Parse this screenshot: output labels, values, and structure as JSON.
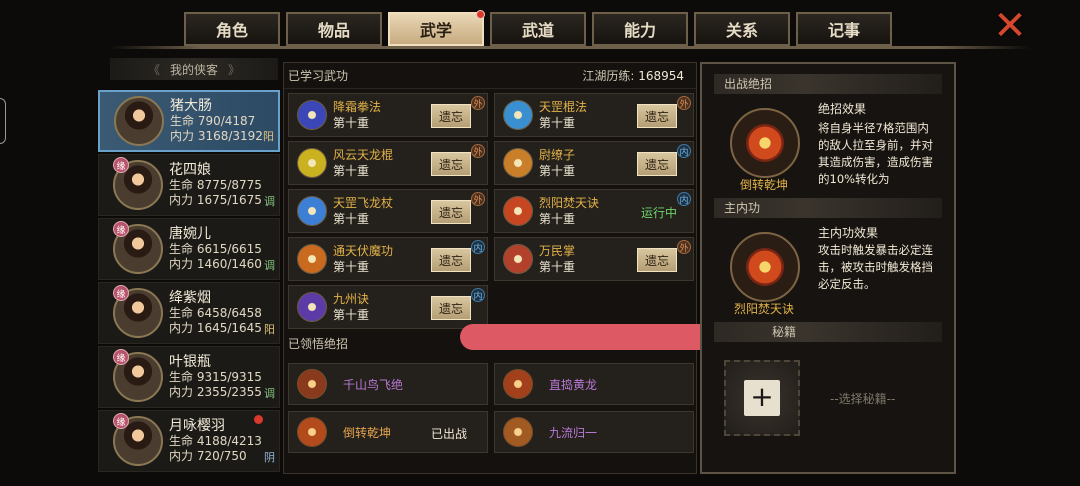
{
  "tabs": [
    {
      "label": "角色",
      "active": false
    },
    {
      "label": "物品",
      "active": false
    },
    {
      "label": "武学",
      "active": true,
      "notify": true
    },
    {
      "label": "武道",
      "active": false
    },
    {
      "label": "能力",
      "active": false
    },
    {
      "label": "关系",
      "active": false
    },
    {
      "label": "记事",
      "active": false
    }
  ],
  "left": {
    "title": "我的侠客",
    "characters": [
      {
        "name": "猪大肠",
        "hp": "生命 790/4187",
        "mp": "内力 3168/3192",
        "tag": "阳",
        "selected": true
      },
      {
        "name": "花四娘",
        "hp": "生命 8775/8775",
        "mp": "内力 1675/1675",
        "tag": "调",
        "badge": "缘"
      },
      {
        "name": "唐婉儿",
        "hp": "生命 6615/6615",
        "mp": "内力 1460/1460",
        "tag": "调",
        "badge": "缘"
      },
      {
        "name": "绛紫烟",
        "hp": "生命 6458/6458",
        "mp": "内力 1645/1645",
        "tag": "阳",
        "badge": "缘"
      },
      {
        "name": "叶银瓶",
        "hp": "生命 9315/9315",
        "mp": "内力 2355/2355",
        "tag": "调",
        "badge": "缘"
      },
      {
        "name": "月咏樱羽",
        "hp": "生命 4188/4213",
        "mp": "内力 720/750",
        "tag": "阴",
        "badge": "缘",
        "notify": true
      }
    ]
  },
  "mid": {
    "learned_title": "已学习武功",
    "exp_label": "江湖历练:",
    "exp_value": "168954",
    "forget_label": "遗忘",
    "running_label": "运行中",
    "skills": [
      {
        "name": "降霜拳法",
        "level": "第十重",
        "type": "外",
        "kind": "out",
        "color": "#3b47b6"
      },
      {
        "name": "天罡棍法",
        "level": "第十重",
        "type": "外",
        "kind": "out",
        "color": "#3a8fd0"
      },
      {
        "name": "风云天龙棍",
        "level": "第十重",
        "type": "外",
        "kind": "out",
        "color": "#c9b11f"
      },
      {
        "name": "尉缭子",
        "level": "第十重",
        "type": "内",
        "kind": "in",
        "color": "#c97f2a"
      },
      {
        "name": "天罡飞龙杖",
        "level": "第十重",
        "type": "外",
        "kind": "out",
        "color": "#3e7fd6"
      },
      {
        "name": "烈阳焚天诀",
        "level": "第十重",
        "type": "内",
        "kind": "in",
        "color": "#c54620",
        "running": true
      },
      {
        "name": "通天伏魔功",
        "level": "第十重",
        "type": "内",
        "kind": "in",
        "color": "#c96a1f"
      },
      {
        "name": "万民掌",
        "level": "第十重",
        "type": "外",
        "kind": "out",
        "color": "#b2402a"
      },
      {
        "name": "九州诀",
        "level": "第十重",
        "type": "内",
        "kind": "in",
        "color": "#5d3ba7"
      }
    ],
    "ult_title": "已领悟绝招",
    "ults": [
      {
        "name": "千山鸟飞绝",
        "style": "purple",
        "color": "#8a3a1c"
      },
      {
        "name": "直捣黄龙",
        "style": "purple",
        "color": "#a1401b"
      },
      {
        "name": "倒转乾坤",
        "style": "orange",
        "color": "#b24a1c",
        "state": "已出战"
      },
      {
        "name": "九流归一",
        "style": "purple",
        "color": "#a05a22"
      }
    ]
  },
  "right": {
    "battle_title": "出战绝招",
    "battle_skill": "倒转乾坤",
    "battle_effect_title": "绝招效果",
    "battle_effect_text": "将自身半径7格范围内的敌人拉至身前，并对其造成伤害，造成伤害的10%转化为",
    "main_title": "主内功",
    "main_skill": "烈阳焚天诀",
    "main_effect_title": "主内功效果",
    "main_effect_text": "攻击时触发暴击必定连击，被攻击时触发格挡必定反击。",
    "secret_title": "秘籍",
    "select_hint": "--选择秘籍--",
    "plus": "+"
  },
  "close": "✕"
}
